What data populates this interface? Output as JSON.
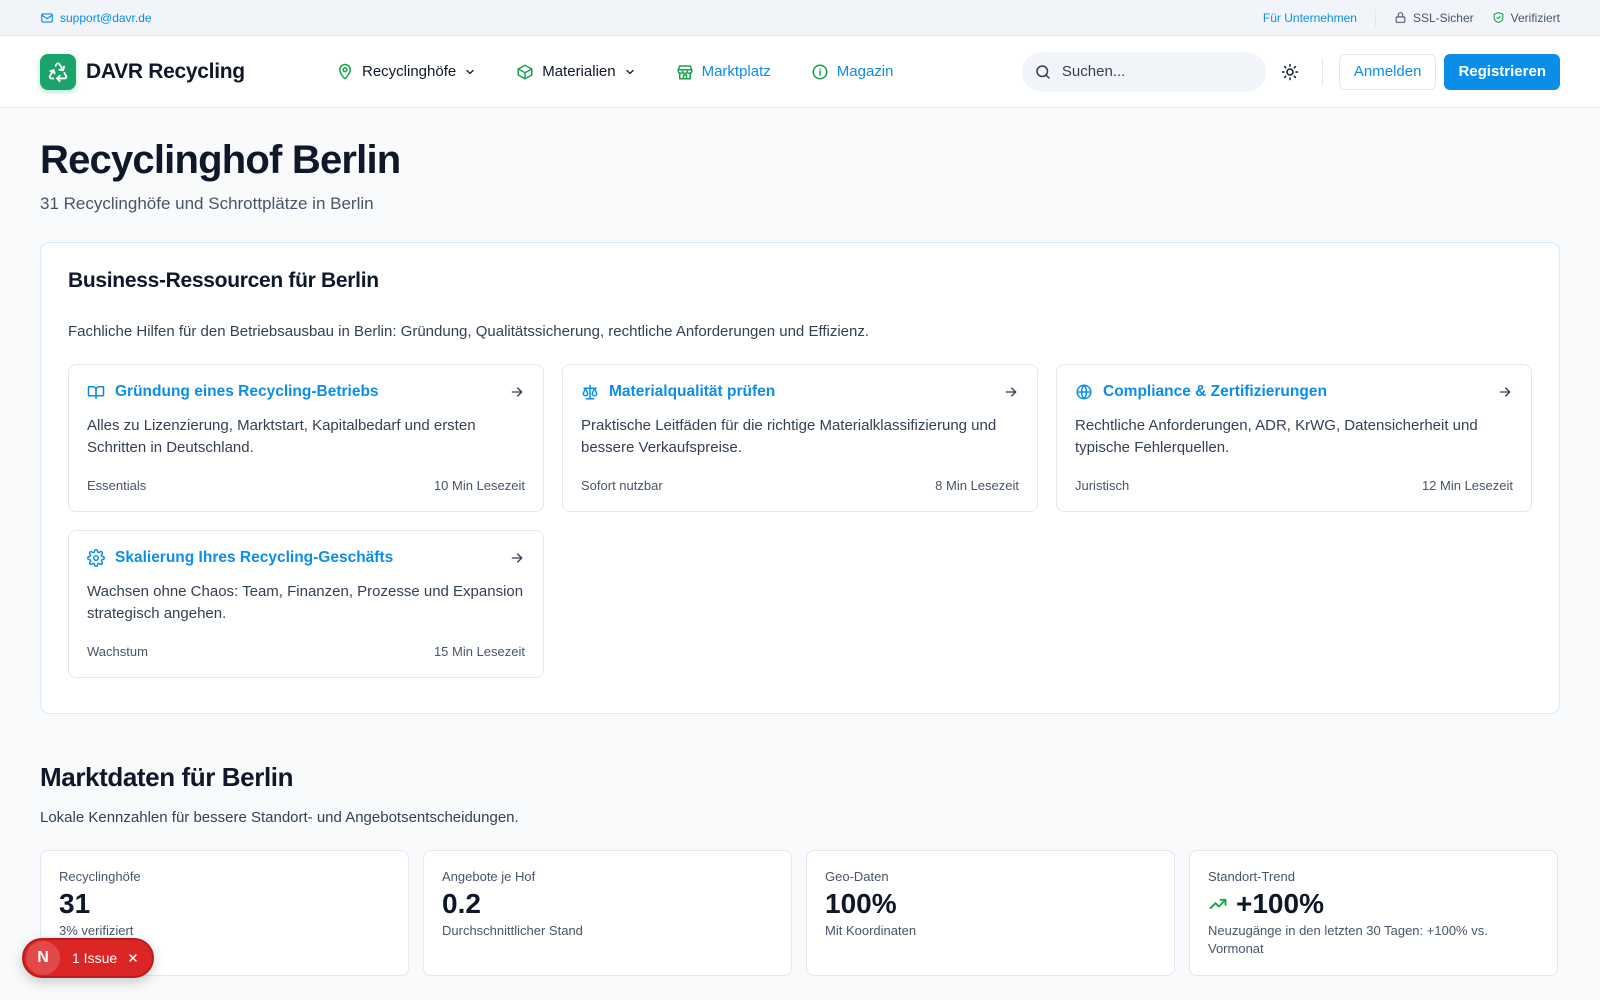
{
  "topbar": {
    "email": "support@davr.de",
    "business_link": "Für Unternehmen",
    "ssl_label": "SSL-Sicher",
    "verified_label": "Verifiziert"
  },
  "header": {
    "brand": "DAVR Recycling",
    "nav": [
      {
        "label": "Recyclinghöfe",
        "icon": "map-pin-icon",
        "dropdown": true
      },
      {
        "label": "Materialien",
        "icon": "package-icon",
        "dropdown": true
      },
      {
        "label": "Marktplatz",
        "icon": "store-icon",
        "dropdown": false
      },
      {
        "label": "Magazin",
        "icon": "info-icon",
        "dropdown": false
      }
    ],
    "search_placeholder": "Suchen...",
    "login_label": "Anmelden",
    "register_label": "Registrieren"
  },
  "page": {
    "title": "Recyclinghof Berlin",
    "subtitle": "31 Recyclinghöfe und Schrottplätze in Berlin"
  },
  "resources": {
    "title": "Business-Ressourcen für Berlin",
    "description": "Fachliche Hilfen für den Betriebsausbau in Berlin: Gründung, Qualitätssicherung, rechtliche Anforderungen und Effizienz.",
    "cards": [
      {
        "title": "Gründung eines Recycling-Betriebs",
        "icon": "book-open-icon",
        "text": "Alles zu Lizenzierung, Marktstart, Kapitalbedarf und ersten Schritten in Deutschland.",
        "tag": "Essentials",
        "time": "10 Min Lesezeit"
      },
      {
        "title": "Materialqualität prüfen",
        "icon": "scale-icon",
        "text": "Praktische Leitfäden für die richtige Materialklassifizierung und bessere Verkaufspreise.",
        "tag": "Sofort nutzbar",
        "time": "8 Min Lesezeit"
      },
      {
        "title": "Compliance & Zertifizierungen",
        "icon": "globe-icon",
        "text": "Rechtliche Anforderungen, ADR, KrWG, Datensicherheit und typische Fehlerquellen.",
        "tag": "Juristisch",
        "time": "12 Min Lesezeit"
      },
      {
        "title": "Skalierung Ihres Recycling-Geschäfts",
        "icon": "gear-icon",
        "text": "Wachsen ohne Chaos: Team, Finanzen, Prozesse und Expansion strategisch angehen.",
        "tag": "Wachstum",
        "time": "15 Min Lesezeit"
      }
    ]
  },
  "market": {
    "title": "Marktdaten für Berlin",
    "description": "Lokale Kennzahlen für bessere Standort- und Angebotsentscheidungen.",
    "stats": [
      {
        "label": "Recyclinghöfe",
        "value": "31",
        "sub": "3% verifiziert"
      },
      {
        "label": "Angebote je Hof",
        "value": "0.2",
        "sub": "Durchschnittlicher Stand"
      },
      {
        "label": "Geo-Daten",
        "value": "100%",
        "sub": "Mit Koordinaten"
      },
      {
        "label": "Standort-Trend",
        "value": "+100%",
        "sub": "Neuzugänge in den letzten 30 Tagen: +100% vs. Vormonat"
      }
    ]
  },
  "issue_badge": {
    "logo": "N",
    "label": "1 Issue"
  },
  "colors": {
    "accent": "#0b8ee8",
    "brand_green": "#1aa36b",
    "issue_red": "#dc2626"
  }
}
